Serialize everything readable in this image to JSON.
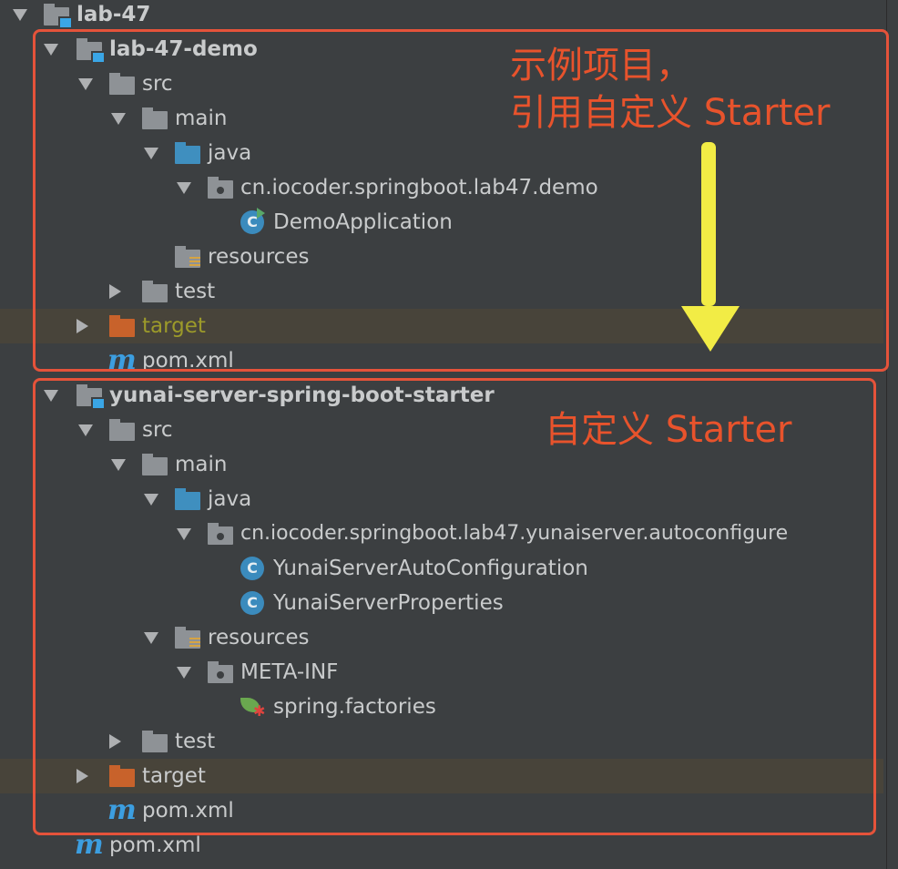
{
  "tree": {
    "root": "lab-47",
    "demo_module": "lab-47-demo",
    "demo_src": "src",
    "demo_main": "main",
    "demo_java": "java",
    "demo_package": "cn.iocoder.springboot.lab47.demo",
    "demo_class": "DemoApplication",
    "demo_resources": "resources",
    "demo_test": "test",
    "demo_target": "target",
    "demo_pom": "pom.xml",
    "starter_module": "yunai-server-spring-boot-starter",
    "starter_src": "src",
    "starter_main": "main",
    "starter_java": "java",
    "starter_package": "cn.iocoder.springboot.lab47.yunaiserver.autoconfigure",
    "starter_class1": "YunaiServerAutoConfiguration",
    "starter_class2": "YunaiServerProperties",
    "starter_resources": "resources",
    "starter_metainf": "META-INF",
    "starter_factories": "spring.factories",
    "starter_test": "test",
    "starter_target": "target",
    "starter_pom": "pom.xml",
    "root_pom": "pom.xml"
  },
  "annotations": {
    "demo_line1": "示例项目，",
    "demo_line2": "引用自定义 Starter",
    "starter_note": "自定义 Starter"
  },
  "colors": {
    "annotation": "#e8532c",
    "highlight_arrow": "#f2ec45"
  }
}
